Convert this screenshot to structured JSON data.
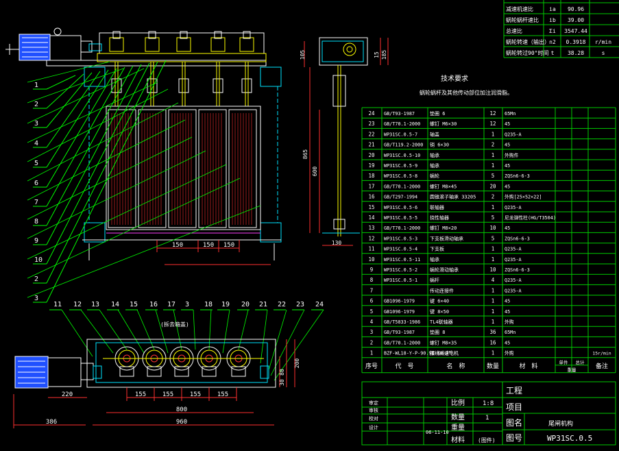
{
  "colors": {
    "background": "#000000",
    "outline": "#ffffff",
    "table_lines": "#00cc00",
    "table_text": "#ffffff",
    "dimension": "#ff3030",
    "leader": "#00ff00",
    "cyan": "#00e5ff",
    "yellow": "#ffff00",
    "magenta": "#ff40ff",
    "motor_blue": "#2050ff"
  },
  "top_param_table": [
    {
      "name": "减速机速比",
      "sym": "ia",
      "val": "90.96",
      "unit": ""
    },
    {
      "name": "蜗轮蜗杆速比",
      "sym": "ib",
      "val": "39.00",
      "unit": ""
    },
    {
      "name": "总速比",
      "sym": "Σi",
      "val": "3547.44",
      "unit": ""
    },
    {
      "name": "蜗轮转速（输出）",
      "sym": "n2",
      "val": "0.3918",
      "unit": "r/min"
    },
    {
      "name": "蜗轮转过90°时间",
      "sym": "t",
      "val": "38.28",
      "unit": "s"
    }
  ],
  "tech_title": "技术要求",
  "tech_note": "蜗轮蜗杆及其他传动部位加注润滑脂。",
  "bom_rows": [
    {
      "no": "24",
      "code": "GB/T93-1987",
      "name": "垫圈 6",
      "qty": "12",
      "mat": "65Mn",
      "note": ""
    },
    {
      "no": "23",
      "code": "GB/T70.1-2000",
      "name": "螺钉 M6×30",
      "qty": "12",
      "mat": "45",
      "note": ""
    },
    {
      "no": "22",
      "code": "WP31SC.0.5-7",
      "name": "轴盖",
      "qty": "1",
      "mat": "Q235-A",
      "note": ""
    },
    {
      "no": "21",
      "code": "GB/T119.2-2000",
      "name": "销 6×30",
      "qty": "2",
      "mat": "45",
      "note": ""
    },
    {
      "no": "20",
      "code": "WP31SC.0.5-10",
      "name": "轴承",
      "qty": "1",
      "mat": "外购件",
      "note": ""
    },
    {
      "no": "19",
      "code": "WP31SC.0.5-9",
      "name": "轴承",
      "qty": "1",
      "mat": "45",
      "note": ""
    },
    {
      "no": "18",
      "code": "WP31SC.0.5-8",
      "name": "蜗轮",
      "qty": "5",
      "mat": "ZQSn6-6-3",
      "note": ""
    },
    {
      "no": "17",
      "code": "GB/T70.1-2000",
      "name": "螺钉 M8×45",
      "qty": "20",
      "mat": "45",
      "note": ""
    },
    {
      "no": "16",
      "code": "GB/T297-1994",
      "name": "圆锥滚子轴承 33205",
      "qty": "2",
      "mat": "外购[25×52×22]",
      "note": ""
    },
    {
      "no": "15",
      "code": "WP31SC.0.5-6",
      "name": "联轴器",
      "qty": "1",
      "mat": "Q235-A",
      "note": ""
    },
    {
      "no": "14",
      "code": "WP31SC.0.5-5",
      "name": "挠性轴器",
      "qty": "5",
      "mat": "尼龙弹性柱(HG/T3504)",
      "note": ""
    },
    {
      "no": "13",
      "code": "GB/T70.1-2000",
      "name": "螺钉 M8×20",
      "qty": "10",
      "mat": "45",
      "note": ""
    },
    {
      "no": "12",
      "code": "WP31SC.0.5-3",
      "name": "下支板滑动轴承",
      "qty": "5",
      "mat": "ZQSn6-6-3",
      "note": ""
    },
    {
      "no": "11",
      "code": "WP31SC.0.5-4",
      "name": "下支板",
      "qty": "1",
      "mat": "Q235-A",
      "note": ""
    },
    {
      "no": "10",
      "code": "WP31SC.0.5-11",
      "name": "轴承",
      "qty": "1",
      "mat": "Q235-A",
      "note": ""
    },
    {
      "no": "9",
      "code": "WP31SC.0.5-2",
      "name": "蜗轮滑动轴承",
      "qty": "10",
      "mat": "ZQSn6-6-3",
      "note": ""
    },
    {
      "no": "8",
      "code": "WP31SC.0.5-1",
      "name": "蜗杆",
      "qty": "4",
      "mat": "Q235-A",
      "note": ""
    },
    {
      "no": "7",
      "code": "",
      "name": "传动连接件",
      "qty": "1",
      "mat": "Q235-A",
      "note": ""
    },
    {
      "no": "6",
      "code": "GB1096-1979",
      "name": "键 6×40",
      "qty": "1",
      "mat": "45",
      "note": ""
    },
    {
      "no": "5",
      "code": "GB1096-1979",
      "name": "键 8×50",
      "qty": "1",
      "mat": "45",
      "note": ""
    },
    {
      "no": "4",
      "code": "GB/T5833-1986",
      "name": "TL4联轴器",
      "qty": "1",
      "mat": "外购",
      "note": ""
    },
    {
      "no": "3",
      "code": "GB/T93-1987",
      "name": "垫圈 8",
      "qty": "36",
      "mat": "65Mn",
      "note": ""
    },
    {
      "no": "2",
      "code": "GB/T70.1-2000",
      "name": "螺钉 M8×35",
      "qty": "16",
      "mat": "45",
      "note": ""
    },
    {
      "no": "1",
      "code": "BZF-WL18-Y-P-90.96-40-0°",
      "name": "摆线减速电机",
      "qty": "1",
      "mat": "外购",
      "note": "15r/min"
    }
  ],
  "bom_header": {
    "no": "序号",
    "code": "代　号",
    "name": "名　称",
    "qty": "数量",
    "mat": "材　料",
    "unit_wt": "单件",
    "total_wt": "总计",
    "wt": "重量",
    "note": "备注"
  },
  "title_block": {
    "left_labels": [
      "审定",
      "审核",
      "校对",
      "设计"
    ],
    "scale_label": "比例",
    "scale_val": "1:8",
    "qty_label": "数量",
    "qty_val": "1",
    "weight_label": "重量",
    "mat_label": "材料",
    "mat_val": "(图件)",
    "date": "06-11-10",
    "project_label": "工程",
    "item_label": "项目",
    "name_label": "图名",
    "name_val": "尾闸机构",
    "no_label": "图号",
    "no_val": "WP31SC.0.5"
  },
  "side_dims": [
    "105",
    "15",
    "185",
    "865",
    "600",
    "130"
  ],
  "front_dims": [
    "150",
    "150",
    "150"
  ],
  "plan_dims": [
    "155",
    "155",
    "155",
    "155",
    "220",
    "800",
    "960",
    "386",
    "80",
    "30",
    "200"
  ],
  "plan_note": "(拆去箱盖)",
  "balloons_left": [
    "1",
    "2",
    "3",
    "4",
    "5",
    "6",
    "7",
    "8",
    "9",
    "10",
    "2",
    "3"
  ],
  "balloons_bottom": [
    "11",
    "12",
    "13",
    "14",
    "15",
    "16",
    "17",
    "3",
    "18",
    "19",
    "20",
    "21",
    "22",
    "23",
    "24"
  ]
}
